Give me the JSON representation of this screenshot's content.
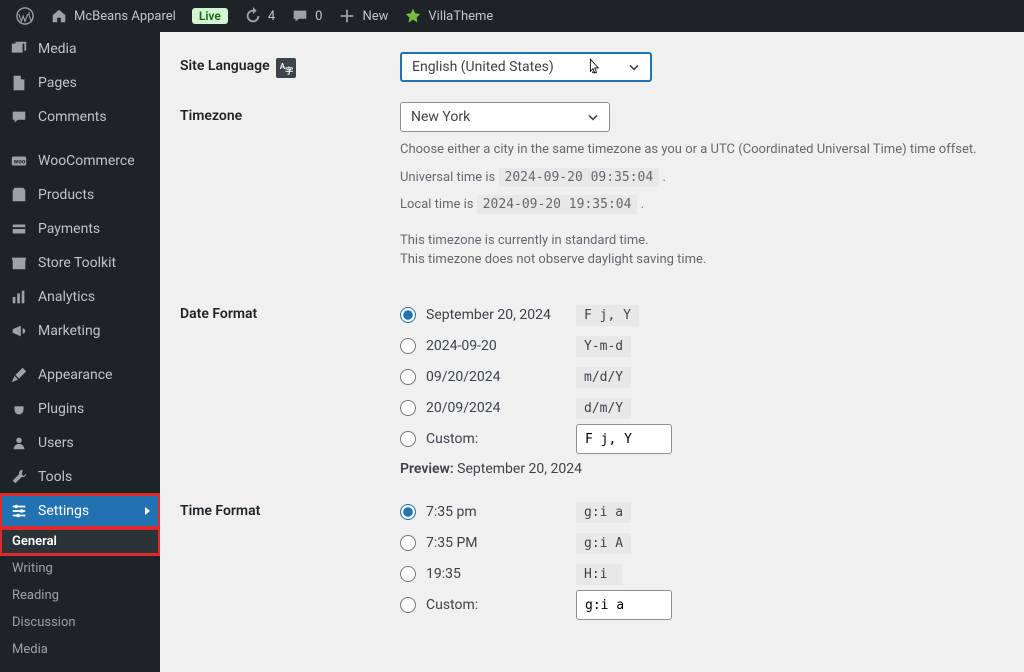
{
  "adminbar": {
    "site_name": "McBeans Apparel",
    "live_badge": "Live",
    "updates_count": "4",
    "comments_count": "0",
    "new_label": "New",
    "plugin_link": "VillaTheme"
  },
  "sidebar": {
    "items": [
      {
        "label": "Media",
        "icon": "media"
      },
      {
        "label": "Pages",
        "icon": "page"
      },
      {
        "label": "Comments",
        "icon": "comment"
      },
      {
        "label": "WooCommerce",
        "icon": "woo"
      },
      {
        "label": "Products",
        "icon": "products"
      },
      {
        "label": "Payments",
        "icon": "payments"
      },
      {
        "label": "Store Toolkit",
        "icon": "store"
      },
      {
        "label": "Analytics",
        "icon": "analytics"
      },
      {
        "label": "Marketing",
        "icon": "marketing"
      },
      {
        "label": "Appearance",
        "icon": "appearance"
      },
      {
        "label": "Plugins",
        "icon": "plugins"
      },
      {
        "label": "Users",
        "icon": "users"
      },
      {
        "label": "Tools",
        "icon": "tools"
      },
      {
        "label": "Settings",
        "icon": "settings"
      }
    ],
    "submenu": [
      {
        "label": "General"
      },
      {
        "label": "Writing"
      },
      {
        "label": "Reading"
      },
      {
        "label": "Discussion"
      },
      {
        "label": "Media"
      }
    ]
  },
  "settings": {
    "site_language": {
      "label": "Site Language",
      "value": "English (United States)"
    },
    "timezone": {
      "label": "Timezone",
      "value": "New York",
      "desc": "Choose either a city in the same timezone as you or a UTC (Coordinated Universal Time) time offset.",
      "universal_label": "Universal time is",
      "universal_value": "2024-09-20 09:35:04",
      "local_label": "Local time is",
      "local_value": "2024-09-20 19:35:04",
      "std_line": "This timezone is currently in standard time.",
      "dst_line": "This timezone does not observe daylight saving time."
    },
    "date_format": {
      "label": "Date Format",
      "options": [
        {
          "display": "September 20, 2024",
          "code": "F j, Y"
        },
        {
          "display": "2024-09-20",
          "code": "Y-m-d"
        },
        {
          "display": "09/20/2024",
          "code": "m/d/Y"
        },
        {
          "display": "20/09/2024",
          "code": "d/m/Y"
        }
      ],
      "custom_label": "Custom:",
      "custom_value": "F j, Y",
      "preview_label": "Preview:",
      "preview_value": "September 20, 2024"
    },
    "time_format": {
      "label": "Time Format",
      "options": [
        {
          "display": "7:35 pm",
          "code": "g:i a"
        },
        {
          "display": "7:35 PM",
          "code": "g:i A"
        },
        {
          "display": "19:35",
          "code": "H:i"
        }
      ],
      "custom_label": "Custom:",
      "custom_value": "g:i a"
    }
  }
}
